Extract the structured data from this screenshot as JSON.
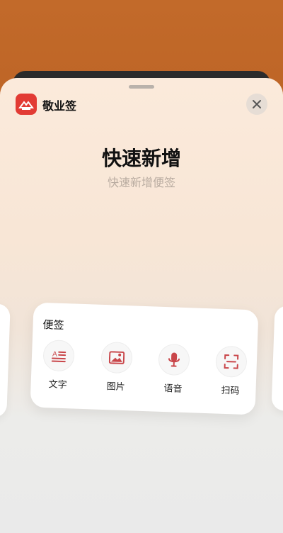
{
  "app": {
    "name": "敬业签"
  },
  "hero": {
    "title": "快速新增",
    "subtitle": "快速新增便签"
  },
  "card": {
    "title": "便签",
    "actions": [
      {
        "label": "文字",
        "icon": "text-icon"
      },
      {
        "label": "图片",
        "icon": "image-icon"
      },
      {
        "label": "语音",
        "icon": "microphone-icon"
      },
      {
        "label": "扫码",
        "icon": "scan-icon"
      }
    ]
  },
  "colors": {
    "accent": "#e23b34",
    "icon_red": "#c9464a"
  }
}
